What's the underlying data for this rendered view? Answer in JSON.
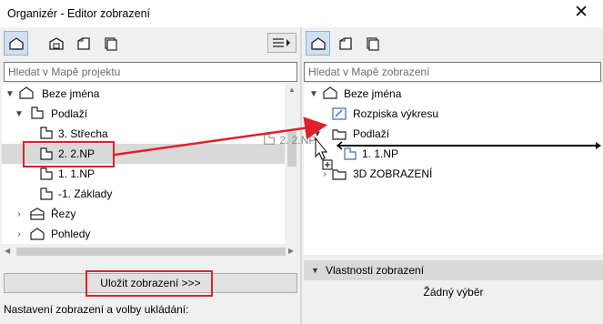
{
  "window": {
    "title": "Organizér - Editor zobrazení",
    "close_glyph": "✕"
  },
  "left": {
    "search_placeholder": "Hledat v Mapě projektu",
    "tree": [
      {
        "label": "Beze jména",
        "icon": "project-house-icon",
        "expanded": true
      },
      {
        "label": "Podlaží",
        "icon": "story-icon",
        "expanded": true
      },
      {
        "label": "3. Střecha",
        "icon": "story-icon"
      },
      {
        "label": "2. 2.NP",
        "icon": "story-icon",
        "selected": true
      },
      {
        "label": "1. 1.NP",
        "icon": "story-icon"
      },
      {
        "label": "-1. Základy",
        "icon": "story-icon"
      },
      {
        "label": "Řezy",
        "icon": "section-icon",
        "expanded": false
      },
      {
        "label": "Pohledy",
        "icon": "elevation-icon",
        "expanded": false
      }
    ],
    "save_button": "Uložit zobrazení >>>",
    "settings_label": "Nastavení zobrazení a volby ukládání:"
  },
  "drag_ghost_label": "2. 2.NP",
  "right": {
    "search_placeholder": "Hledat v Mapě zobrazení",
    "tree": [
      {
        "label": "Beze jména",
        "icon": "project-house-icon",
        "expanded": true
      },
      {
        "label": "Rozpiska výkresu",
        "icon": "drawing-sheet-icon"
      },
      {
        "label": "Podlaží",
        "icon": "folder-icon",
        "expanded": true
      },
      {
        "label": "1. 1.NP",
        "icon": "story-icon"
      },
      {
        "label": "3D ZOBRAZENÍ",
        "icon": "folder-icon",
        "expanded": false
      }
    ],
    "props_title": "Vlastnosti zobrazení",
    "props_value": "Žádný výběr"
  },
  "colors": {
    "highlight_red": "#e0202a",
    "selection_gray": "#d9d9d9",
    "drop_line": "#000000",
    "icon_blue": "#3b6fb5"
  }
}
